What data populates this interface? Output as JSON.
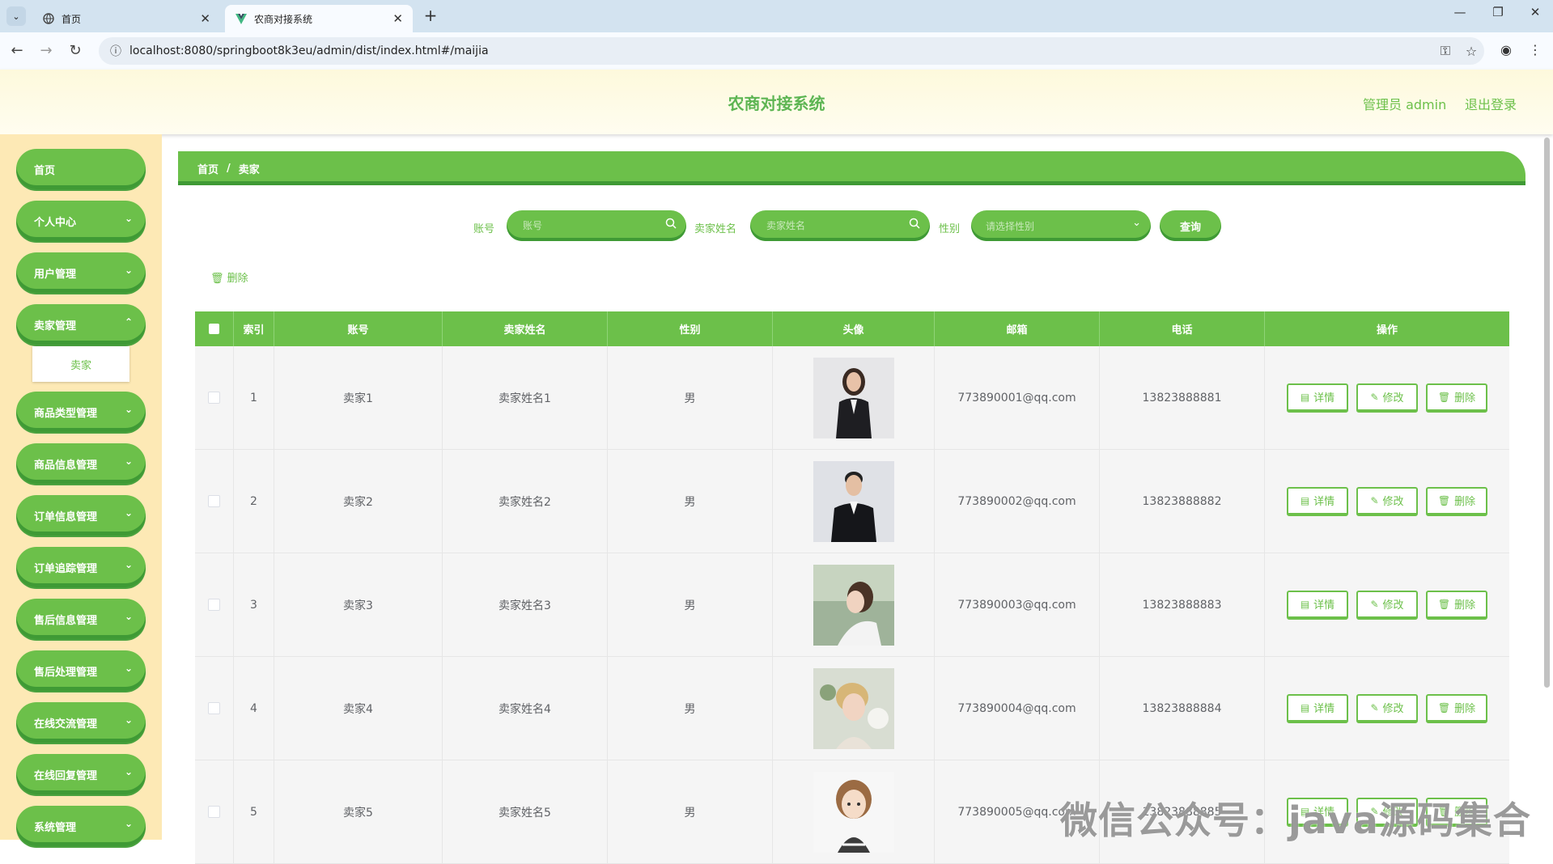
{
  "browser": {
    "tabs": [
      {
        "title": "首页",
        "active": false
      },
      {
        "title": "农商对接系统",
        "active": true
      }
    ],
    "url": "localhost:8080/springboot8k3eu/admin/dist/index.html#/maijia"
  },
  "header": {
    "title": "农商对接系统",
    "user": "管理员 admin",
    "logout": "退出登录"
  },
  "sidebar": {
    "items": [
      {
        "label": "首页",
        "has_arrow": false
      },
      {
        "label": "个人中心",
        "has_arrow": true
      },
      {
        "label": "用户管理",
        "has_arrow": true
      },
      {
        "label": "卖家管理",
        "has_arrow": true
      },
      {
        "label": "商品类型管理",
        "has_arrow": true
      },
      {
        "label": "商品信息管理",
        "has_arrow": true
      },
      {
        "label": "订单信息管理",
        "has_arrow": true
      },
      {
        "label": "订单追踪管理",
        "has_arrow": true
      },
      {
        "label": "售后信息管理",
        "has_arrow": true
      },
      {
        "label": "售后处理管理",
        "has_arrow": true
      },
      {
        "label": "在线交流管理",
        "has_arrow": true
      },
      {
        "label": "在线回复管理",
        "has_arrow": true
      },
      {
        "label": "系统管理",
        "has_arrow": true
      }
    ],
    "submenu": {
      "label": "卖家"
    }
  },
  "breadcrumb": {
    "home": "首页",
    "separator": "/",
    "current": "卖家"
  },
  "search": {
    "account_label": "账号",
    "account_placeholder": "账号",
    "name_label": "卖家姓名",
    "name_placeholder": "卖家姓名",
    "gender_label": "性别",
    "gender_placeholder": "请选择性别",
    "query_button": "查询"
  },
  "bulk_delete": "删除",
  "table": {
    "columns": [
      "索引",
      "账号",
      "卖家姓名",
      "性别",
      "头像",
      "邮箱",
      "电话",
      "操作"
    ],
    "actions": {
      "detail": "详情",
      "edit": "修改",
      "delete": "删除"
    },
    "rows": [
      {
        "index": "1",
        "account": "卖家1",
        "name": "卖家姓名1",
        "gender": "男",
        "email": "773890001@qq.com",
        "phone": "13823888881"
      },
      {
        "index": "2",
        "account": "卖家2",
        "name": "卖家姓名2",
        "gender": "男",
        "email": "773890002@qq.com",
        "phone": "13823888882"
      },
      {
        "index": "3",
        "account": "卖家3",
        "name": "卖家姓名3",
        "gender": "男",
        "email": "773890003@qq.com",
        "phone": "13823888883"
      },
      {
        "index": "4",
        "account": "卖家4",
        "name": "卖家姓名4",
        "gender": "男",
        "email": "773890004@qq.com",
        "phone": "13823888884"
      },
      {
        "index": "5",
        "account": "卖家5",
        "name": "卖家姓名5",
        "gender": "男",
        "email": "773890005@qq.com",
        "phone": "13823888885"
      }
    ]
  },
  "watermark": "微信公众号：java源码集合",
  "colors": {
    "primary": "#6cc04a",
    "primary_dark": "#3f9a35",
    "sidebar_bg": "#fde9b5",
    "header_bg": "#fdf9dc"
  }
}
